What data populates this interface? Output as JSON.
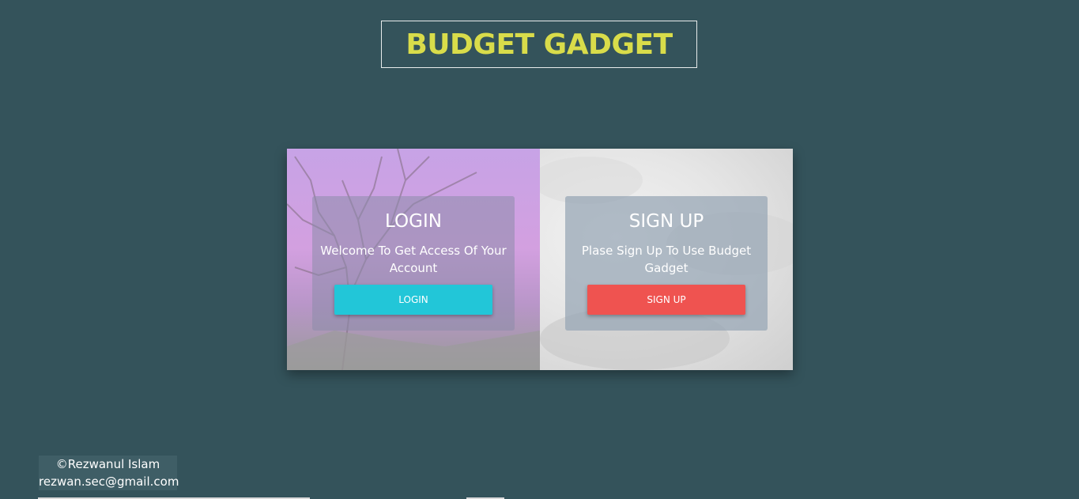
{
  "header": {
    "title": "BUDGET GADGET",
    "title_color": "#d9dc4a",
    "border_color": "#e8ecec"
  },
  "page": {
    "background_color": "#34535b"
  },
  "login": {
    "heading": "LOGIN",
    "description": "Welcome To Get Access Of Your Account",
    "button_label": "LOGIN",
    "button_color": "#22c6d8"
  },
  "signup": {
    "heading": "SIGN UP",
    "description": "Plase Sign Up To Use Budget Gadget",
    "button_label": "SIGN UP",
    "button_color": "#ef5350"
  },
  "footer": {
    "copyright": "©Rezwanul Islam",
    "email": "rezwan.sec@gmail.com"
  }
}
